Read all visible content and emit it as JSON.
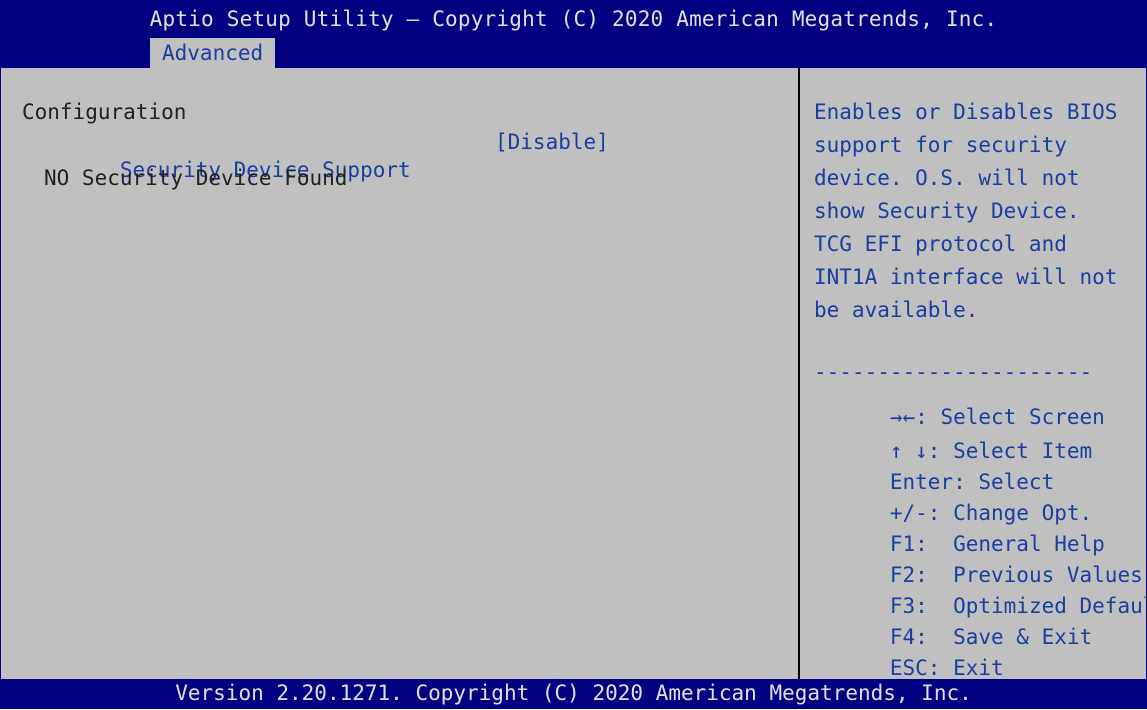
{
  "header": {
    "title": "Aptio Setup Utility – Copyright (C) 2020 American Megatrends, Inc.",
    "active_tab": "Advanced"
  },
  "main": {
    "section_label": "Configuration",
    "settings": [
      {
        "label": "Security Device Support",
        "value": "[Disable]"
      }
    ],
    "status_text": "NO Security Device Found"
  },
  "help": {
    "lines": [
      "Enables or Disables BIOS",
      "support for security",
      "device. O.S. will not",
      "show Security Device.",
      "TCG EFI protocol and",
      "INT1A interface will not",
      "be available."
    ],
    "separator": "----------------------",
    "keys": [
      {
        "icon": "left-right-arrows-icon",
        "key": "→←",
        "desc": ": Select Screen"
      },
      {
        "icon": "up-down-arrows-icon",
        "key": "↑ ↓",
        "desc": ": Select Item"
      },
      {
        "icon": "",
        "key": "Enter",
        "desc": ": Select"
      },
      {
        "icon": "",
        "key": "+/-",
        "desc": ": Change Opt."
      },
      {
        "icon": "",
        "key": "F1",
        "desc": ":  General Help"
      },
      {
        "icon": "",
        "key": "F2",
        "desc": ":  Previous Values"
      },
      {
        "icon": "",
        "key": "F3",
        "desc": ":  Optimized Defaults"
      },
      {
        "icon": "",
        "key": "F4",
        "desc": ":  Save & Exit"
      },
      {
        "icon": "",
        "key": "ESC",
        "desc": ": Exit"
      }
    ]
  },
  "footer": {
    "version": "Version 2.20.1271. Copyright (C) 2020 American Megatrends, Inc."
  },
  "colors": {
    "header_bg": "#000080",
    "panel_bg": "#c0c0c0",
    "highlight_text": "#1a3da0",
    "normal_text": "#202020"
  }
}
